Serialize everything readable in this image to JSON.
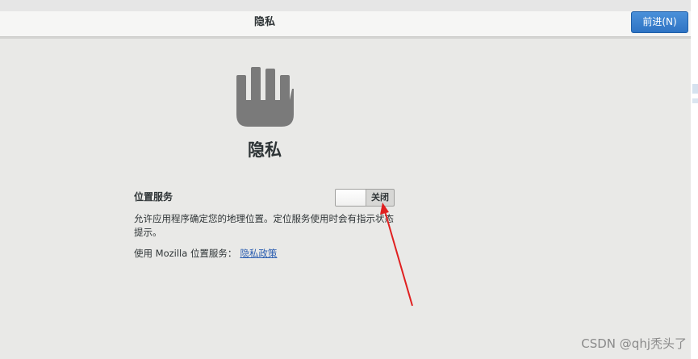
{
  "header": {
    "title": "隐私",
    "next_button_label": "前进(N)"
  },
  "privacy": {
    "icon": "hand-stop-icon",
    "page_title": "隐私",
    "location_services_label": "位置服务",
    "toggle_state_label": "关闭",
    "toggle_on": false,
    "description": "允许应用程序确定您的地理位置。定位服务使用时会有指示状态提示。",
    "mozilla_text": "使用 Mozilla 位置服务：",
    "privacy_policy_link": "隐私政策"
  },
  "colors": {
    "accent": "#3a82cf",
    "annotation": "#e02020",
    "icon": "#7a7a7a"
  },
  "watermark": "CSDN @qhj秃头了"
}
